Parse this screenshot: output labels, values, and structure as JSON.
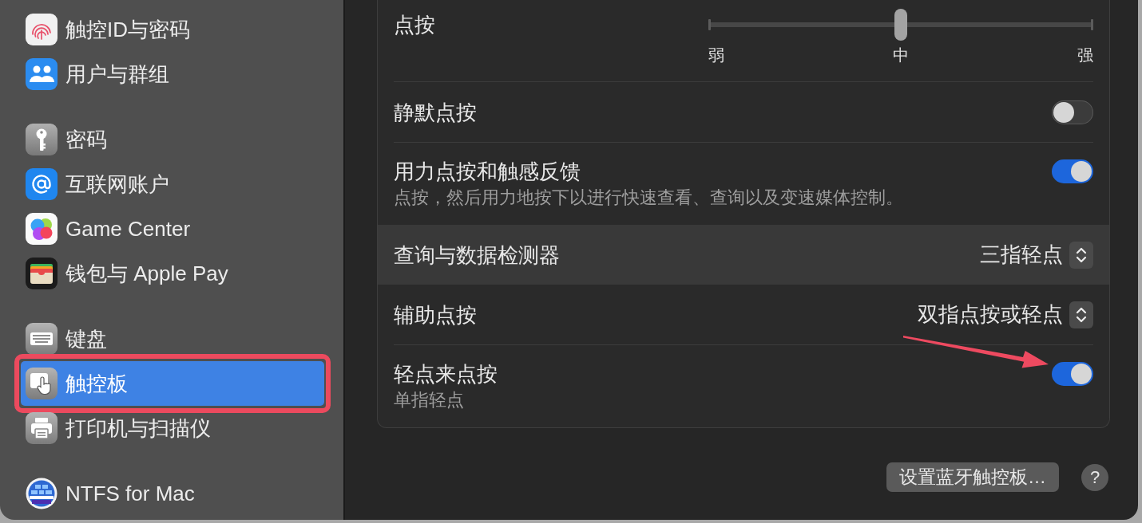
{
  "sidebar": {
    "groups": [
      {
        "items": [
          {
            "label": "触控ID与密码",
            "selected": false,
            "annotated": false
          },
          {
            "label": "用户与群组",
            "selected": false,
            "annotated": false
          }
        ]
      },
      {
        "items": [
          {
            "label": "密码",
            "selected": false,
            "annotated": false
          },
          {
            "label": "互联网账户",
            "selected": false,
            "annotated": false
          },
          {
            "label": "Game Center",
            "selected": false,
            "annotated": false
          },
          {
            "label": "钱包与 Apple Pay",
            "selected": false,
            "annotated": false
          }
        ]
      },
      {
        "items": [
          {
            "label": "键盘",
            "selected": false,
            "annotated": false
          },
          {
            "label": "触控板",
            "selected": true,
            "annotated": true
          },
          {
            "label": "打印机与扫描仪",
            "selected": false,
            "annotated": false
          }
        ]
      },
      {
        "items": [
          {
            "label": "NTFS for Mac",
            "selected": false,
            "annotated": false
          }
        ]
      }
    ]
  },
  "settings": {
    "rows": [
      {
        "kind": "slider",
        "label": "点按",
        "level": 0.5,
        "ticks": [
          "弱",
          "中",
          "强"
        ],
        "highlighted": false,
        "annotated": false
      },
      {
        "kind": "toggle",
        "label": "静默点按",
        "on": false,
        "highlighted": false,
        "annotated": false
      },
      {
        "kind": "toggle",
        "label": "用力点按和触感反馈",
        "description": "点按，然后用力地按下以进行快速查看、查询以及变速媒体控制。",
        "on": true,
        "highlighted": false,
        "annotated": false
      },
      {
        "kind": "popup",
        "label": "查询与数据检测器",
        "value": "三指轻点",
        "highlighted": true,
        "annotated": false
      },
      {
        "kind": "popup",
        "label": "辅助点按",
        "value": "双指点按或轻点",
        "highlighted": false,
        "annotated": false
      },
      {
        "kind": "toggle",
        "label": "轻点来点按",
        "description": "单指轻点",
        "on": true,
        "highlighted": false,
        "annotated": true
      }
    ]
  },
  "footer": {
    "buttons": [
      {
        "kind": "text",
        "label": "设置蓝牙触控板…"
      },
      {
        "kind": "help",
        "label": "?"
      }
    ]
  }
}
